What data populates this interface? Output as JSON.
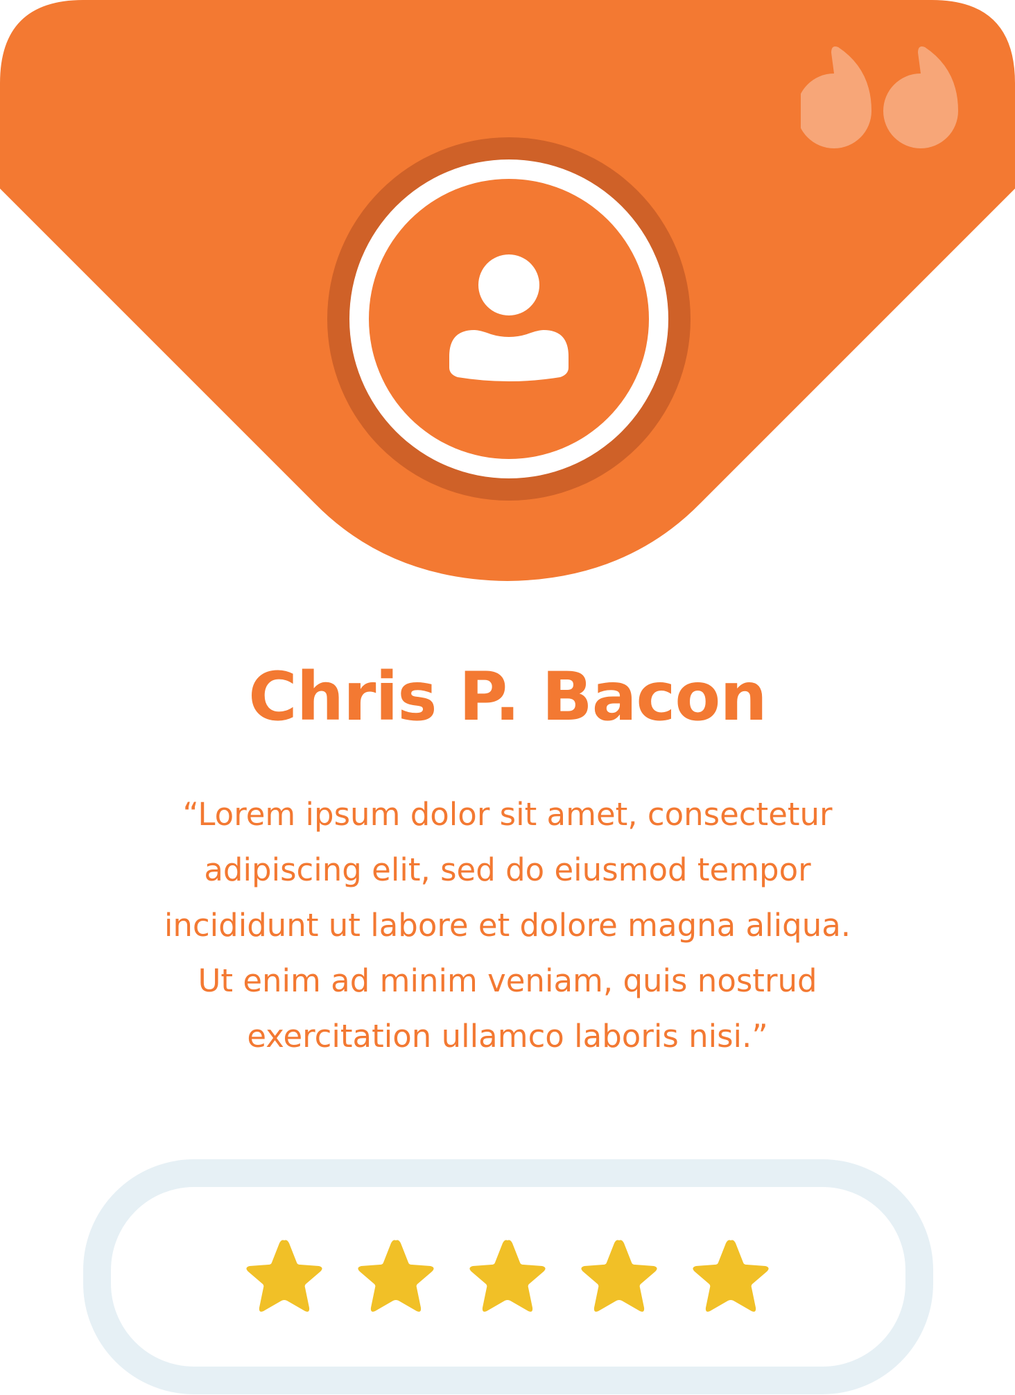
{
  "colors": {
    "accent": "#f37932",
    "accent_dark": "#cf6128",
    "quote_mark": "#f7a678",
    "star": "#f1c027",
    "rating_border": "#e6f0f5",
    "background": "#ffffff"
  },
  "header": {
    "avatar_icon": "user-icon",
    "quote_icon": "quote-mark-icon"
  },
  "testimonial": {
    "name": "Chris P. Bacon",
    "quote": "“Lorem ipsum dolor sit amet, consectetur\nadipiscing elit, sed do eiusmod tempor\nincididunt ut labore et dolore magna aliqua.\nUt enim ad minim veniam, quis nostrud\nexercitation ullamco laboris nisi.”"
  },
  "rating": {
    "value": 5,
    "max": 5,
    "icon": "star-icon"
  }
}
